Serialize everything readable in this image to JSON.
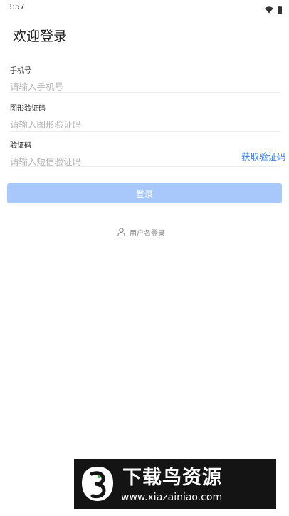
{
  "status_bar": {
    "time": "3:57",
    "icons": [
      "wifi-icon",
      "battery-icon"
    ]
  },
  "page": {
    "title": "欢迎登录"
  },
  "form": {
    "phone": {
      "label": "手机号",
      "value": "",
      "placeholder": "请输入手机号"
    },
    "captcha": {
      "label": "图形验证码",
      "value": "",
      "placeholder": "请输入图形验证码"
    },
    "sms_code": {
      "label": "验证码",
      "value": "",
      "placeholder": "请输入短信验证码",
      "get_code_label": "获取验证码"
    },
    "login_button_label": "登录",
    "alt_login_label": "用户名登录",
    "alt_login_icon": "user-icon"
  },
  "watermark": {
    "title": "下载鸟资源",
    "url": "www.xiazainiao.com"
  },
  "colors": {
    "accent": "#3a80e0",
    "login_button_disabled": "#a8c8fb",
    "placeholder": "#b4b4b4",
    "divider": "#ededed"
  }
}
